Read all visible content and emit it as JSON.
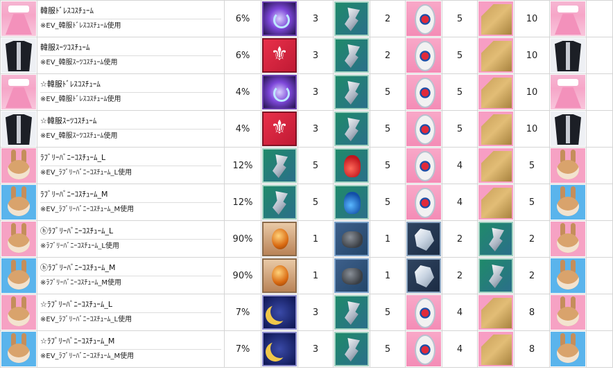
{
  "rows": [
    {
      "icon": "korean-dress-icon",
      "icon_class": "cos-dress",
      "name": "韓服ﾄﾞﾚｽｺｽﾁｭｰﾑ",
      "note": "※EV_韓服ﾄﾞﾚｽｺｽﾁｭｰﾑ使用",
      "rate": "6%",
      "materials": [
        {
          "icon": "purple-orb-icon",
          "icon_class": "m-orb",
          "qty": "3"
        },
        {
          "icon": "silver-shard-icon",
          "icon_class": "m-shard",
          "qty": "2"
        },
        {
          "icon": "taegeuk-gem-icon",
          "icon_class": "m-tae",
          "qty": "5"
        },
        {
          "icon": "straw-mat-icon",
          "icon_class": "m-straw",
          "qty": "10"
        }
      ],
      "result_icon": "korean-dress-icon",
      "result_class": "cos-dress"
    },
    {
      "icon": "korean-suit-icon",
      "icon_class": "cos-suit",
      "name": "韓服ｽｰﾂｺｽﾁｭｰﾑ",
      "note": "※EV_韓服ｽｰﾂｺｽﾁｭｰﾑ使用",
      "rate": "6%",
      "materials": [
        {
          "icon": "fleur-de-lis-crest-icon",
          "icon_class": "m-flag",
          "qty": "3"
        },
        {
          "icon": "silver-shard-icon",
          "icon_class": "m-shard",
          "qty": "2"
        },
        {
          "icon": "taegeuk-gem-icon",
          "icon_class": "m-tae",
          "qty": "5"
        },
        {
          "icon": "straw-mat-icon",
          "icon_class": "m-straw",
          "qty": "10"
        }
      ],
      "result_icon": "korean-suit-icon",
      "result_class": "cos-suit"
    },
    {
      "icon": "korean-dress-icon",
      "icon_class": "cos-dress",
      "name": "☆韓服ﾄﾞﾚｽｺｽﾁｭｰﾑ",
      "note": "※EV_韓服ﾄﾞﾚｽｺｽﾁｭｰﾑ使用",
      "rate": "4%",
      "materials": [
        {
          "icon": "purple-orb-icon",
          "icon_class": "m-orb",
          "qty": "3"
        },
        {
          "icon": "silver-shard-icon",
          "icon_class": "m-shard",
          "qty": "5"
        },
        {
          "icon": "taegeuk-gem-icon",
          "icon_class": "m-tae",
          "qty": "5"
        },
        {
          "icon": "straw-mat-icon",
          "icon_class": "m-straw",
          "qty": "10"
        }
      ],
      "result_icon": "korean-dress-icon",
      "result_class": "cos-dress"
    },
    {
      "icon": "korean-suit-icon",
      "icon_class": "cos-suit",
      "name": "☆韓服ｽｰﾂｺｽﾁｭｰﾑ",
      "note": "※EV_韓服ｽｰﾂｺｽﾁｭｰﾑ使用",
      "rate": "4%",
      "materials": [
        {
          "icon": "fleur-de-lis-crest-icon",
          "icon_class": "m-flag",
          "qty": "3"
        },
        {
          "icon": "silver-shard-icon",
          "icon_class": "m-shard",
          "qty": "5"
        },
        {
          "icon": "taegeuk-gem-icon",
          "icon_class": "m-tae",
          "qty": "5"
        },
        {
          "icon": "straw-mat-icon",
          "icon_class": "m-straw",
          "qty": "10"
        }
      ],
      "result_icon": "korean-suit-icon",
      "result_class": "cos-suit"
    },
    {
      "icon": "bunny-pink-icon",
      "icon_class": "bunny bunny-pink",
      "name": "ﾗﾌﾞﾘｰﾊﾞﾆｰｺｽﾁｭｰﾑ_L",
      "note": "※EV_ﾗﾌﾞﾘｰﾊﾞﾆｰｺｽﾁｭｰﾑ_L使用",
      "rate": "12%",
      "materials": [
        {
          "icon": "silver-shard-icon",
          "icon_class": "m-shard",
          "qty": "5"
        },
        {
          "icon": "red-pouch-icon",
          "icon_class": "m-redbag",
          "qty": "5"
        },
        {
          "icon": "taegeuk-gem-icon",
          "icon_class": "m-tae",
          "qty": "4"
        },
        {
          "icon": "straw-mat-icon",
          "icon_class": "m-straw",
          "qty": "5"
        }
      ],
      "result_icon": "bunny-pink-icon",
      "result_class": "bunny bunny-pink"
    },
    {
      "icon": "bunny-blue-icon",
      "icon_class": "bunny bunny-blue",
      "name": "ﾗﾌﾞﾘｰﾊﾞﾆｰｺｽﾁｭｰﾑ_M",
      "note": "※EV_ﾗﾌﾞﾘｰﾊﾞﾆｰｺｽﾁｭｰﾑ_M使用",
      "rate": "12%",
      "materials": [
        {
          "icon": "silver-shard-icon",
          "icon_class": "m-shard",
          "qty": "5"
        },
        {
          "icon": "blue-pouch-icon",
          "icon_class": "m-bluebag",
          "qty": "5"
        },
        {
          "icon": "taegeuk-gem-icon",
          "icon_class": "m-tae",
          "qty": "4"
        },
        {
          "icon": "straw-mat-icon",
          "icon_class": "m-straw",
          "qty": "5"
        }
      ],
      "result_icon": "bunny-blue-icon",
      "result_class": "bunny bunny-blue"
    },
    {
      "icon": "bunny-pink-icon",
      "icon_class": "bunny bunny-pink",
      "name": "ⓗﾗﾌﾞﾘｰﾊﾞﾆｰｺｽﾁｭｰﾑ_L",
      "note": "※ﾗﾌﾞﾘｰﾊﾞﾆｰｺｽﾁｭｰﾑ_L使用",
      "rate": "90%",
      "materials": [
        {
          "icon": "amber-egg-icon",
          "icon_class": "m-egg",
          "qty": "1"
        },
        {
          "icon": "dark-ore-icon",
          "icon_class": "m-rock",
          "qty": "1"
        },
        {
          "icon": "clear-crystal-icon",
          "icon_class": "m-crystal",
          "qty": "2"
        },
        {
          "icon": "silver-shard-icon",
          "icon_class": "m-shard",
          "qty": "2"
        }
      ],
      "result_icon": "bunny-pink-icon",
      "result_class": "bunny bunny-pink"
    },
    {
      "icon": "bunny-blue-icon",
      "icon_class": "bunny bunny-blue",
      "name": "ⓗﾗﾌﾞﾘｰﾊﾞﾆｰｺｽﾁｭｰﾑ_M",
      "note": "※ﾗﾌﾞﾘｰﾊﾞﾆｰｺｽﾁｭｰﾑ_M使用",
      "rate": "90%",
      "materials": [
        {
          "icon": "amber-egg-icon",
          "icon_class": "m-egg",
          "qty": "1"
        },
        {
          "icon": "dark-ore-icon",
          "icon_class": "m-rock",
          "qty": "1"
        },
        {
          "icon": "clear-crystal-icon",
          "icon_class": "m-crystal",
          "qty": "2"
        },
        {
          "icon": "silver-shard-icon",
          "icon_class": "m-shard",
          "qty": "2"
        }
      ],
      "result_icon": "bunny-blue-icon",
      "result_class": "bunny bunny-blue"
    },
    {
      "icon": "bunny-pink-icon",
      "icon_class": "bunny bunny-pink",
      "name": "☆ﾗﾌﾞﾘｰﾊﾞﾆｰｺｽﾁｭｰﾑ_L",
      "note": "※EV_ﾗﾌﾞﾘｰﾊﾞﾆｰｺｽﾁｭｰﾑ_L使用",
      "rate": "7%",
      "materials": [
        {
          "icon": "crescent-moon-icon",
          "icon_class": "m-moon",
          "qty": "3"
        },
        {
          "icon": "silver-shard-icon",
          "icon_class": "m-shard",
          "qty": "5"
        },
        {
          "icon": "taegeuk-gem-icon",
          "icon_class": "m-tae",
          "qty": "4"
        },
        {
          "icon": "straw-mat-icon",
          "icon_class": "m-straw",
          "qty": "8"
        }
      ],
      "result_icon": "bunny-pink-icon",
      "result_class": "bunny bunny-pink"
    },
    {
      "icon": "bunny-blue-icon",
      "icon_class": "bunny bunny-blue",
      "name": "☆ﾗﾌﾞﾘｰﾊﾞﾆｰｺｽﾁｭｰﾑ_M",
      "note": "※EV_ﾗﾌﾞﾘｰﾊﾞﾆｰｺｽﾁｭｰﾑ_M使用",
      "rate": "7%",
      "materials": [
        {
          "icon": "crescent-moon-icon",
          "icon_class": "m-moon",
          "qty": "3"
        },
        {
          "icon": "silver-shard-icon",
          "icon_class": "m-shard",
          "qty": "5"
        },
        {
          "icon": "taegeuk-gem-icon",
          "icon_class": "m-tae",
          "qty": "4"
        },
        {
          "icon": "straw-mat-icon",
          "icon_class": "m-straw",
          "qty": "8"
        }
      ],
      "result_icon": "bunny-blue-icon",
      "result_class": "bunny bunny-blue"
    }
  ]
}
